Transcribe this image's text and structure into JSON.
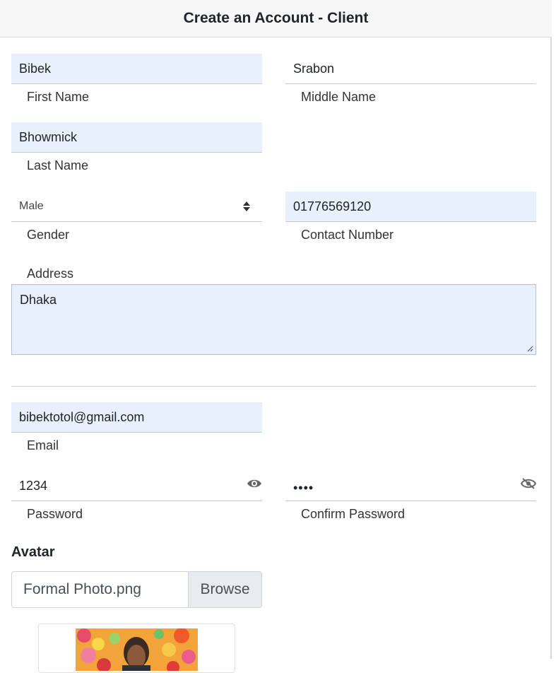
{
  "header": {
    "title": "Create an Account - Client"
  },
  "fields": {
    "first_name": {
      "value": "Bibek",
      "label": "First Name"
    },
    "middle_name": {
      "value": "Srabon",
      "label": "Middle Name"
    },
    "last_name": {
      "value": "Bhowmick",
      "label": "Last Name"
    },
    "gender": {
      "value": "Male",
      "label": "Gender"
    },
    "contact": {
      "value": "01776569120",
      "label": "Contact Number"
    },
    "address": {
      "value": "Dhaka",
      "label": "Address"
    },
    "email": {
      "value": "bibektotol@gmail.com",
      "label": "Email"
    },
    "password": {
      "value": "1234",
      "label": "Password"
    },
    "confirm_password": {
      "value": "••••",
      "label": "Confirm Password"
    }
  },
  "avatar": {
    "title": "Avatar",
    "file_name": "Formal Photo.png",
    "browse_label": "Browse"
  },
  "icons": {
    "password_visibility": "eye-icon",
    "confirm_visibility": "eye-slash-icon"
  },
  "colors": {
    "autofill_bg": "#e8f0fe",
    "header_bg": "#f7f7f7"
  }
}
